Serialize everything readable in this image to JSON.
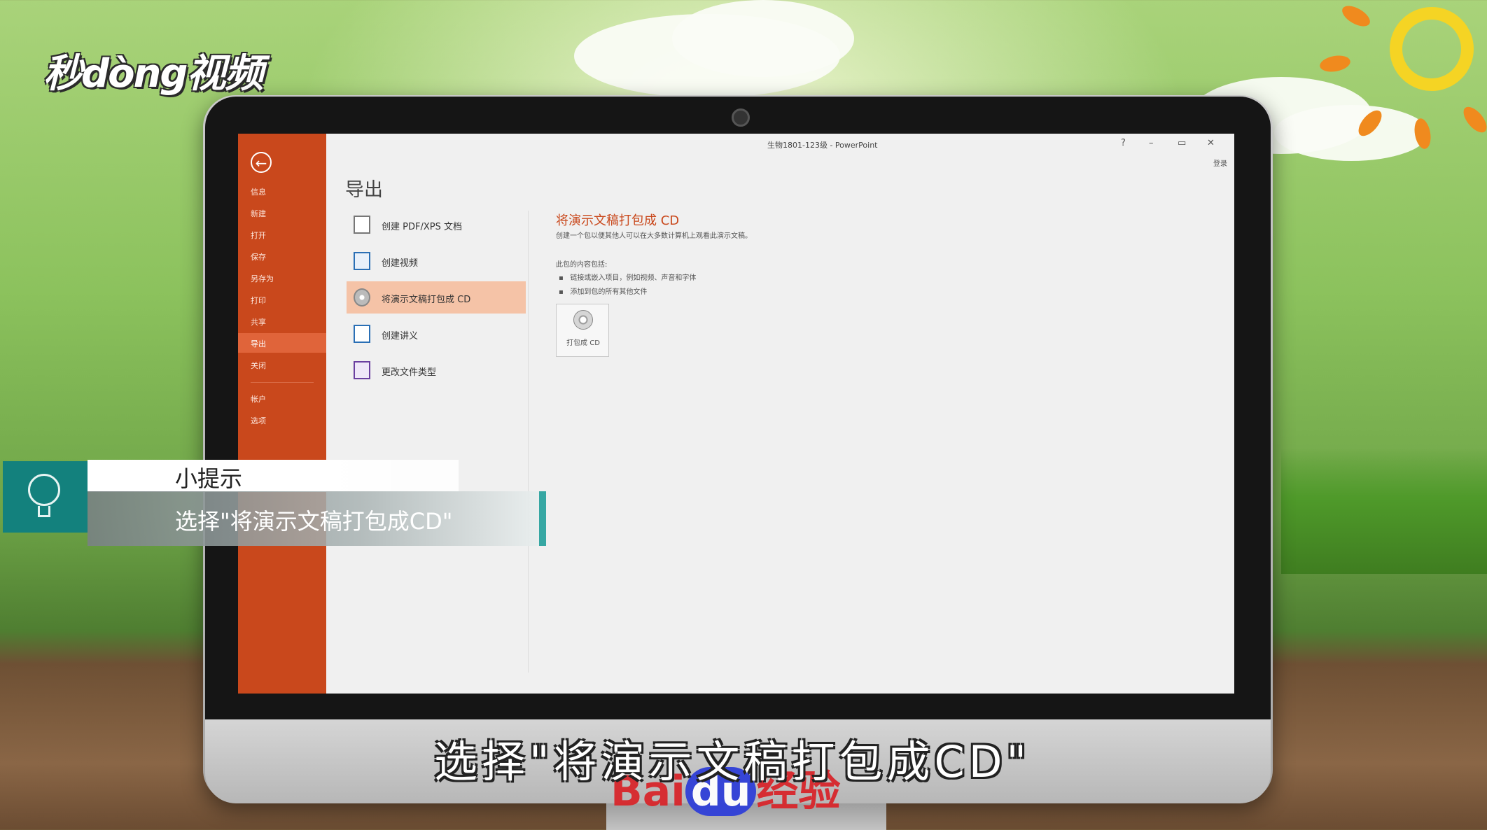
{
  "brand": {
    "logo_text": "秒dòng视频"
  },
  "window": {
    "title": "生物1801-123级 - PowerPoint",
    "help": "?",
    "minimize": "–",
    "restore": "▭",
    "close": "✕",
    "sign_in": "登录"
  },
  "sidebar": {
    "back_icon": "←",
    "items": [
      "信息",
      "新建",
      "打开",
      "保存",
      "另存为",
      "打印",
      "共享",
      "导出",
      "关闭",
      "帐户",
      "选项"
    ],
    "active_index": 7
  },
  "export": {
    "title": "导出",
    "menu": [
      {
        "label": "创建 PDF/XPS 文档",
        "icon": "pdf-doc-icon"
      },
      {
        "label": "创建视频",
        "icon": "video-icon"
      },
      {
        "label": "将演示文稿打包成 CD",
        "icon": "cd-icon"
      },
      {
        "label": "创建讲义",
        "icon": "handout-icon"
      },
      {
        "label": "更改文件类型",
        "icon": "file-type-icon"
      }
    ],
    "active_index": 2
  },
  "pane": {
    "title": "将演示文稿打包成 CD",
    "description": "创建一个包以便其他人可以在大多数计算机上观看此演示文稿。",
    "includes_label": "此包的内容包括:",
    "bullets": [
      "链接或嵌入项目，例如视频、声音和字体",
      "添加到包的所有其他文件"
    ],
    "button_label": "打包成 CD"
  },
  "tip": {
    "heading": "小提示",
    "body": "选择\"将演示文稿打包成CD\""
  },
  "subtitle": "选择\"将演示文稿打包成CD\"",
  "watermark": {
    "left": "Bai",
    "mid": "du",
    "right": "经验"
  },
  "colors": {
    "accent": "#c9481c",
    "active": "#f5c3a7",
    "tip": "#13817d"
  }
}
